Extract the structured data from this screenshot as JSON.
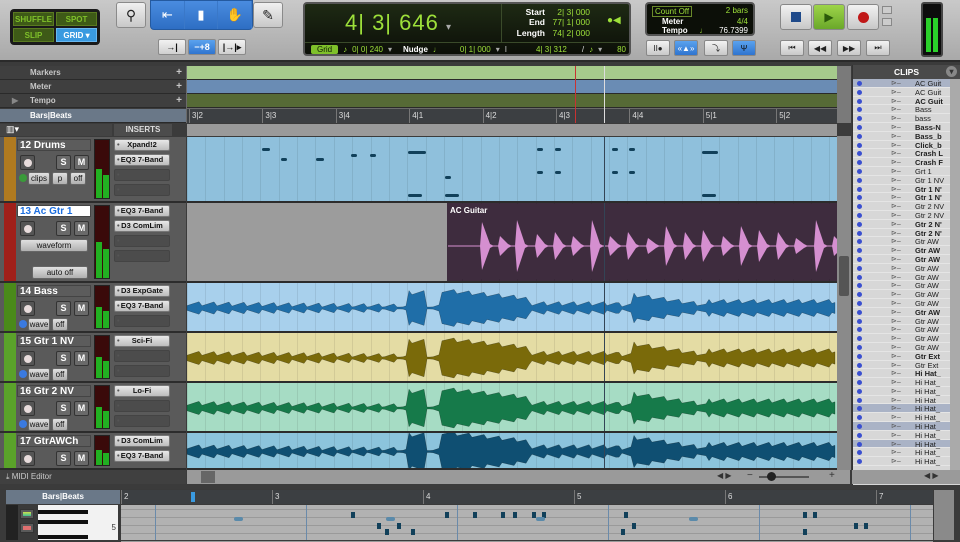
{
  "edit_modes": {
    "shuffle": "SHUFFLE",
    "spot": "SPOT",
    "slip": "SLIP",
    "grid": "GRID"
  },
  "tools": {
    "zoom": "zoom-tool",
    "trim": "trim-tool",
    "select": "selector-tool",
    "grab": "grabber-tool",
    "pencil": "pencil-tool"
  },
  "counter": {
    "main": "4| 3| 646",
    "start_label": "Start",
    "start": "2| 3| 000",
    "end_label": "End",
    "end": "77| 1| 000",
    "length_label": "Length",
    "length": "74| 2| 000",
    "grid_label": "Grid",
    "grid_value": "0| 0| 240",
    "nudge_label": "Nudge",
    "nudge_value": "0| 1| 000",
    "cursor": "4| 3| 312",
    "tempo_note_value": "80"
  },
  "countoff": {
    "count_off_label": "Count Off",
    "count_off_value": "2 bars",
    "meter_label": "Meter",
    "meter_value": "4/4",
    "tempo_label": "Tempo",
    "tempo_value": "76.7399"
  },
  "rulers": {
    "markers": "Markers",
    "meter": "Meter",
    "tempo": "Tempo",
    "bars_beats": "Bars|Beats",
    "plus": "+"
  },
  "ticks": [
    "3|2",
    "3|3",
    "3|4",
    "4|1",
    "4|2",
    "4|3",
    "4|4",
    "5|1",
    "5|2"
  ],
  "inserts_header": "INSERTS",
  "tracks": [
    {
      "num_name": "12  Drums",
      "color": "#b07a20",
      "btns": [
        "clips",
        "p",
        "off"
      ],
      "inserts": [
        "Xpand!2",
        "EQ3 7-Band",
        "",
        ""
      ]
    },
    {
      "num_name": "13  Ac Gtr 1",
      "color": "#a0201a",
      "selected": true,
      "view": "waveform",
      "auto": "auto off",
      "inserts": [
        "EQ3 7-Band",
        "D3 ComLim",
        "",
        ""
      ]
    },
    {
      "num_name": "14   Bass",
      "color": "#4a8a1a",
      "btns": [
        "wave",
        "off"
      ],
      "inserts": [
        "D3 ExpGate",
        "EQ3 7-Band",
        ""
      ]
    },
    {
      "num_name": "15  Gtr 1 NV",
      "color": "#5aa22a",
      "btns": [
        "wave",
        "off"
      ],
      "inserts": [
        "Sci-Fi",
        "",
        ""
      ]
    },
    {
      "num_name": "16  Gtr 2 NV",
      "color": "#5aa22a",
      "btns": [
        "wave",
        "off"
      ],
      "inserts": [
        "Lo-Fi",
        "",
        ""
      ]
    },
    {
      "num_name": "17  GtrAWCh",
      "color": "#5aa22a",
      "btns": [],
      "inserts": [
        "D3 ComLim",
        "EQ3 7-Band"
      ]
    }
  ],
  "s_label": "S",
  "m_label": "M",
  "clip_name": "AC Guitar",
  "midi_editor_label": "MIDI Editor",
  "clips": {
    "title": "CLIPS",
    "items": [
      {
        "n": "AC Guit",
        "b": false,
        "hl": true
      },
      {
        "n": "AC Guit",
        "b": false
      },
      {
        "n": "AC Guit",
        "b": true
      },
      {
        "n": "Bass",
        "b": false
      },
      {
        "n": "bass",
        "b": false
      },
      {
        "n": "Bass-N",
        "b": true
      },
      {
        "n": "Bass_b",
        "b": true
      },
      {
        "n": "Click_b",
        "b": true
      },
      {
        "n": "Crash L",
        "b": true
      },
      {
        "n": "Crash F",
        "b": true
      },
      {
        "n": "Grt 1",
        "b": false
      },
      {
        "n": "Gtr 1 NV",
        "b": false
      },
      {
        "n": "Gtr 1 N'",
        "b": true
      },
      {
        "n": "Gtr 1 N'",
        "b": true
      },
      {
        "n": "Gtr 2 NV",
        "b": false
      },
      {
        "n": "Gtr 2 NV",
        "b": false
      },
      {
        "n": "Gtr 2 N'",
        "b": true
      },
      {
        "n": "Gtr 2 N'",
        "b": true
      },
      {
        "n": "Gtr AW",
        "b": false
      },
      {
        "n": "Gtr AW",
        "b": true
      },
      {
        "n": "Gtr AW",
        "b": true
      },
      {
        "n": "Gtr AW",
        "b": false
      },
      {
        "n": "Gtr AW",
        "b": false
      },
      {
        "n": "Gtr AW",
        "b": false
      },
      {
        "n": "Gtr AW",
        "b": false
      },
      {
        "n": "Gtr AW",
        "b": false
      },
      {
        "n": "Gtr AW",
        "b": true
      },
      {
        "n": "Gtr AW",
        "b": false
      },
      {
        "n": "Gtr AW",
        "b": false
      },
      {
        "n": "Gtr AW",
        "b": false
      },
      {
        "n": "Gtr AW",
        "b": false
      },
      {
        "n": "Gtr Ext",
        "b": true
      },
      {
        "n": "Gtr Ext",
        "b": false
      },
      {
        "n": "Hi Hat_",
        "b": true
      },
      {
        "n": "Hi Hat_",
        "b": false
      },
      {
        "n": "Hi Hat_",
        "b": false
      },
      {
        "n": "Hi Hat_",
        "b": false
      },
      {
        "n": "Hi Hat_",
        "b": false,
        "hl": true
      },
      {
        "n": "Hi Hat_",
        "b": false
      },
      {
        "n": "Hi Hat_",
        "b": false,
        "hl": true
      },
      {
        "n": "Hi Hat_",
        "b": false
      },
      {
        "n": "Hi Hat_",
        "b": false,
        "hl": true
      },
      {
        "n": "Hi Hat_",
        "b": false
      },
      {
        "n": "Hi Hat_",
        "b": false
      }
    ]
  },
  "midi": {
    "bars_beats": "Bars|Beats",
    "ticks": [
      "2",
      "3",
      "4",
      "5",
      "6",
      "7"
    ],
    "octave_label": "5"
  },
  "colors": {
    "drums_lane": "#8fc0dc",
    "acgtr_lane": "#3e2c3e",
    "acgtr_wave": "#d58fd0",
    "bass_lane": "#a8d0ec",
    "bass_wave": "#1f6ea8",
    "gtr1_lane": "#e4dca4",
    "gtr1_wave": "#7a6a0a",
    "gtr2_lane": "#a6dcc4",
    "gtr2_wave": "#167a4a",
    "gtrawch_lane": "#8cc4dc",
    "gtrawch_wave": "#0f4f72"
  }
}
